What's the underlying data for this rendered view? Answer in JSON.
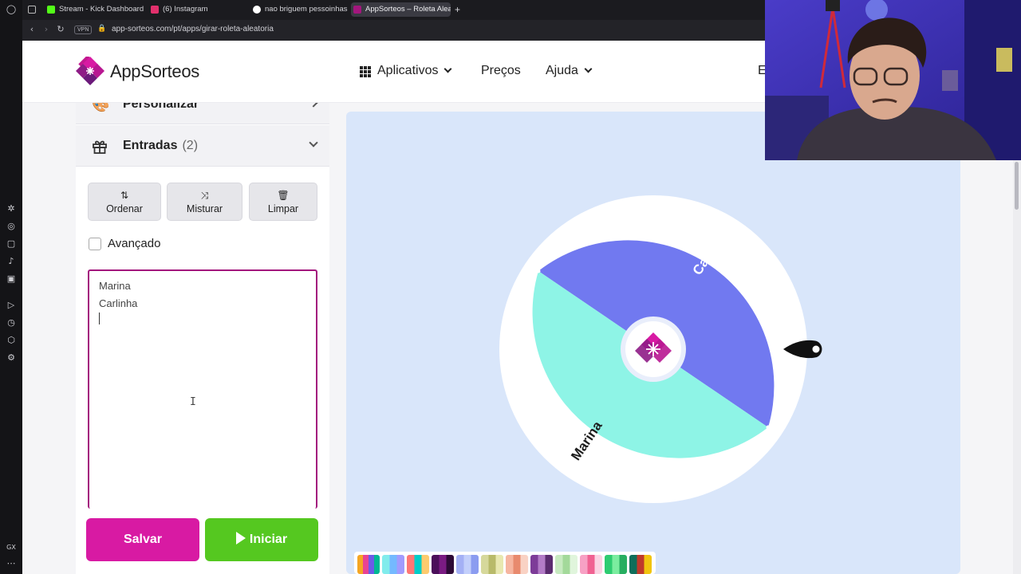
{
  "browser": {
    "tabs": [
      {
        "label": "Stream - Kick Dashboard",
        "icon": "kick-icon",
        "color": "#53fc18"
      },
      {
        "label": "(6) Instagram",
        "icon": "instagram-icon",
        "color": "#e1306c"
      },
      {
        "label": "nao briguem pessoinhas",
        "icon": "google-icon",
        "color": "#ffffff"
      },
      {
        "label": "AppSorteos – Roleta Aleatória",
        "icon": "appsorteos-icon",
        "color": "#a3167d"
      }
    ],
    "vpn_label": "VPN",
    "url": "app-sorteos.com/pt/apps/girar-roleta-aleatoria"
  },
  "header": {
    "brand": "AppSorteos",
    "nav": {
      "apps": "Aplicativos",
      "prices": "Preços",
      "help": "Ajuda",
      "lang": "E"
    }
  },
  "panel": {
    "customize_label": "Personalizar",
    "entries_label": "Entradas",
    "entries_count": "(2)",
    "tools": {
      "sort": "Ordenar",
      "shuffle": "Misturar",
      "clear": "Limpar"
    },
    "advanced_label": "Avançado",
    "entries": [
      "Marina",
      "Carlinha"
    ],
    "cursor_glyph": "I",
    "save_label": "Salvar",
    "start_label": "Iniciar"
  },
  "wheel": {
    "segments": [
      {
        "name": "Carlinha",
        "color": "#7179f0"
      },
      {
        "name": "Marina",
        "color": "#8ef4e6"
      }
    ],
    "center_logo": "appsorteos-logo"
  },
  "palette": {
    "swatches": [
      [
        "#f5a623",
        "#e84393",
        "#6c5ce7",
        "#00b894"
      ],
      [
        "#81ecec",
        "#74b9ff",
        "#a29bfe"
      ],
      [
        "#ff7675",
        "#00cec9",
        "#fdcb6e"
      ],
      [
        "#4b0f5a",
        "#7a1b82",
        "#2d0a36"
      ],
      [
        "#a4b0f5",
        "#c3cffb",
        "#8b9cf0"
      ],
      [
        "#d6d89b",
        "#b8ba6a",
        "#e8e8b0"
      ],
      [
        "#f6b5a0",
        "#e88a6e",
        "#f9d2c4"
      ],
      [
        "#7d3c98",
        "#b37cc7",
        "#5b2c6f"
      ],
      [
        "#c7eac0",
        "#a3d99a",
        "#e0f5dc"
      ],
      [
        "#f7a1c4",
        "#f06292",
        "#fbd3e3"
      ],
      [
        "#2ecc71",
        "#7bed9f",
        "#27ae60"
      ],
      [
        "#0f6e5a",
        "#c0392b",
        "#f1c40f"
      ]
    ]
  },
  "colors": {
    "brand_magenta": "#d81aa3",
    "start_green": "#55c820",
    "focus_border": "#a3167d",
    "wheel_background": "#d9e6fa"
  }
}
